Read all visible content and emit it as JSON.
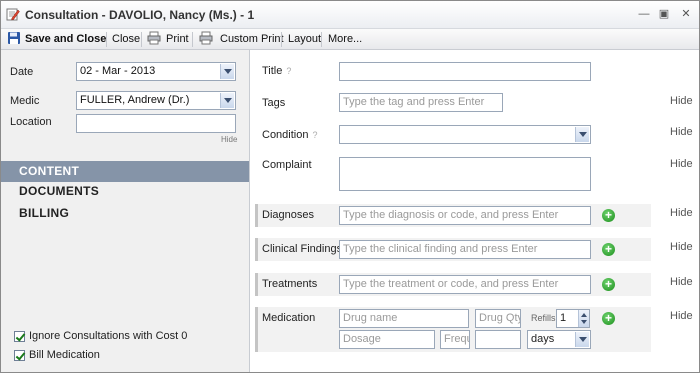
{
  "window": {
    "title": "Consultation - DAVOLIO, Nancy (Ms.) - 1",
    "controls": [
      "minimize",
      "maximize",
      "close"
    ]
  },
  "toolbar": {
    "save_close": "Save and Close",
    "close": "Close",
    "print": "Print",
    "custom_print": "Custom Print",
    "layout": "Layout",
    "more": "More..."
  },
  "left": {
    "date_label": "Date",
    "date_value": "02 - Mar - 2013",
    "medic_label": "Medic",
    "medic_value": "FULLER, Andrew (Dr.)",
    "location_label": "Location",
    "location_value": "",
    "location_hide": "Hide",
    "nav": [
      {
        "label": "CONTENT",
        "active": true
      },
      {
        "label": "DOCUMENTS",
        "active": false
      },
      {
        "label": "BILLING",
        "active": false
      }
    ],
    "checkboxes": [
      {
        "label": "Ignore Consultations with Cost 0",
        "checked": true
      },
      {
        "label": "Bill Medication",
        "checked": true
      }
    ]
  },
  "right": {
    "title_label": "Title",
    "title_help": "?",
    "title_value": "",
    "tags_label": "Tags",
    "tags_placeholder": "Type the tag and press Enter",
    "condition_label": "Condition",
    "condition_help": "?",
    "condition_value": "",
    "complaint_label": "Complaint",
    "complaint_value": "",
    "diagnoses_label": "Diagnoses",
    "diagnoses_placeholder": "Type the diagnosis or code, and press Enter",
    "findings_label": "Clinical Findings",
    "findings_placeholder": "Type the clinical finding and press Enter",
    "treatments_label": "Treatments",
    "treatments_placeholder": "Type the treatment or code, and press Enter",
    "medication_label": "Medication",
    "drug_name_placeholder": "Drug name",
    "drug_qty_placeholder": "Drug Qty",
    "refills_label": "Refills",
    "refills_value": "1",
    "dosage_placeholder": "Dosage",
    "frequency_placeholder": "Frequ",
    "duration_value": "",
    "duration_unit": "days",
    "hide": "Hide"
  },
  "colors": {
    "nav_active_bg": "#8594a8",
    "add_button": "#1c8f1c"
  }
}
